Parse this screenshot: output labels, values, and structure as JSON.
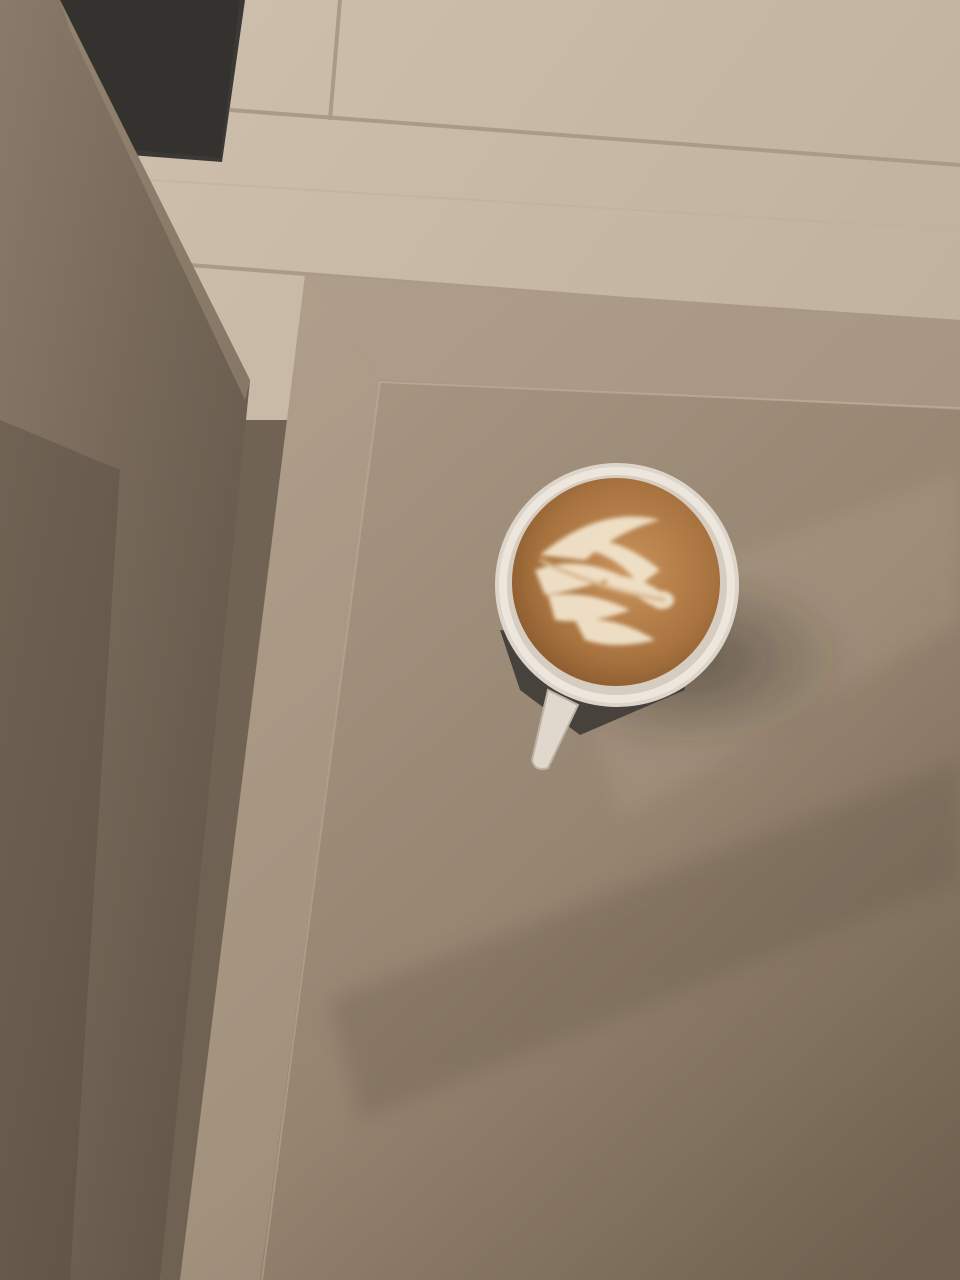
{
  "scene": {
    "description_visible_text": "",
    "colors": {
      "floor_light": "#c9bba9",
      "floor_mid": "#b3a592",
      "floor_dark": "#8d7e6c",
      "table_top": "#a4937f",
      "table_top_shade": "#7d6c5a",
      "table_edge_light": "#c7b8a5",
      "left_slab": "#7a6b5b",
      "left_slab_shade": "#5e5143",
      "dark_object": "#3a3834",
      "cup_rim": "#e8e1d6",
      "cup_shadow": "#c9c0b3",
      "latte_base": "#b07c48",
      "latte_dark": "#8a5a2e",
      "foam": "#efe2cc",
      "handle": "#ddd5ca",
      "saucer": "#4a4440"
    },
    "objects": [
      {
        "name": "floor",
        "icon": "wood-floor"
      },
      {
        "name": "side-table",
        "icon": "table-top"
      },
      {
        "name": "left-furniture-slab",
        "icon": "furniture-slab"
      },
      {
        "name": "dark-panel",
        "icon": "dark-panel"
      },
      {
        "name": "latte-cup",
        "icon": "coffee-cup-icon"
      }
    ]
  }
}
